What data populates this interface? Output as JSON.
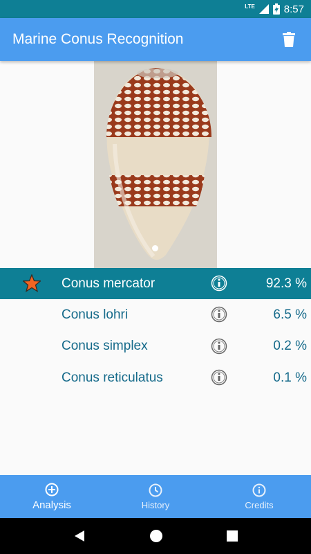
{
  "status_bar": {
    "network": "LTE",
    "time": "8:57"
  },
  "app_bar": {
    "title": "Marine Conus Recognition",
    "delete_icon": "trash-icon"
  },
  "results": [
    {
      "name": "Conus mercator",
      "percent": "92.3 %",
      "selected": true
    },
    {
      "name": "Conus lohri",
      "percent": "6.5 %",
      "selected": false
    },
    {
      "name": "Conus simplex",
      "percent": "0.2 %",
      "selected": false
    },
    {
      "name": "Conus reticulatus",
      "percent": "0.1 %",
      "selected": false
    }
  ],
  "bottom_nav": [
    {
      "label": "Analysis",
      "icon": "add-circle-icon",
      "active": true
    },
    {
      "label": "History",
      "icon": "clock-icon",
      "active": false
    },
    {
      "label": "Credits",
      "icon": "info-circle-icon",
      "active": false
    }
  ],
  "colors": {
    "status_bar": "#0e7f95",
    "app_bar": "#4b9cef",
    "selected_row": "#0e7f95",
    "text_accent": "#156a8a"
  }
}
